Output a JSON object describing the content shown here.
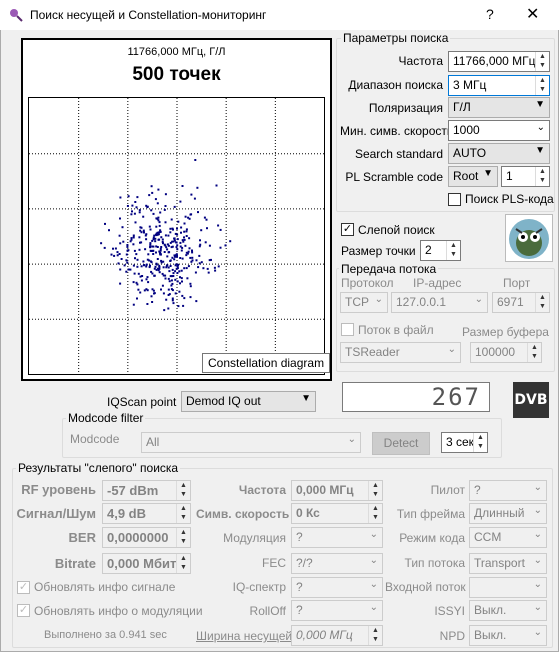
{
  "window": {
    "title": "Поиск несущей и Constellation-мониторинг",
    "help": "?",
    "close": "✕"
  },
  "plot": {
    "freq_label": "11766,000 МГц, Г/Л",
    "points_label": "500 точек",
    "tooltip": "Constellation diagram"
  },
  "search_params": {
    "title": "Параметры поиска",
    "freq_label": "Частота",
    "freq_value": "11766,000 МГц",
    "range_label": "Диапазон поиска",
    "range_value": "3 МГц",
    "pol_label": "Поляризация",
    "pol_value": "Г/Л",
    "minsr_label": "Мин. симв. скорость",
    "minsr_value": "1000",
    "std_label": "Search standard",
    "std_value": "AUTO",
    "pls_label": "PL Scramble code",
    "pls_mode": "Root",
    "pls_value": "1",
    "pls_search_label": "Поиск PLS-кода"
  },
  "blind": {
    "label": "Слепой поиск",
    "point_size_label": "Размер точки",
    "point_size_value": "2"
  },
  "stream": {
    "title": "Передача потока",
    "protocol_label": "Протокол",
    "ip_label": "IP-адрес",
    "port_label": "Порт",
    "protocol_value": "TCP",
    "ip_value": "127.0.0.1",
    "port_value": "6971",
    "file_label": "Поток в файл",
    "buffer_label": "Размер буфера",
    "reader_value": "TSReader",
    "buffer_value": "100000"
  },
  "counter": "267",
  "dvb_logo": "DVB",
  "iq": {
    "label": "IQScan point",
    "value": "Demod IQ out"
  },
  "modcode": {
    "title": "Modcode filter",
    "label": "Modcode",
    "value": "All",
    "detect": "Detect",
    "timeout": "3 сек"
  },
  "results": {
    "title": "Результаты \"слепого\" поиска",
    "rf_label": "RF уровень",
    "rf_value": "-57 dBm",
    "snr_label": "Сигнал/Шум",
    "snr_value": "4,9 dB",
    "ber_label": "BER",
    "ber_value": "0,0000000",
    "bitrate_label": "Bitrate",
    "bitrate_value": "0,000 Мбит",
    "upd_signal_label": "Обновлять инфо сигнале",
    "upd_mod_label": "Обновлять инфо о модуляции",
    "done_label": "Выполнено за 0.941 sec",
    "freq_label": "Частота",
    "freq_value": "0,000 МГц",
    "sr_label": "Симв. скорость",
    "sr_value": "0 Кс",
    "mod_label": "Модуляция",
    "mod_value": "?",
    "fec_label": "FEC",
    "fec_value": "?/?",
    "iqspec_label": "IQ-спектр",
    "iqspec_value": "?",
    "rolloff_label": "RollOff",
    "rolloff_value": "?",
    "bw_label": "Ширина несущей",
    "bw_value": "0,000 МГц",
    "pilot_label": "Пилот",
    "pilot_value": "?",
    "frame_label": "Тип фрейма",
    "frame_value": "Длинный",
    "codemode_label": "Режим кода",
    "codemode_value": "CCM",
    "streamtype_label": "Тип потока",
    "streamtype_value": "Transport",
    "instream_label": "Входной поток",
    "instream_value": "",
    "issyi_label": "ISSYI",
    "issyi_value": "Выкл.",
    "npd_label": "NPD",
    "npd_value": "Выкл."
  },
  "colors": {
    "dot": "#000080",
    "accent": "#0078d7",
    "window_bg": "#f0f0f0"
  }
}
